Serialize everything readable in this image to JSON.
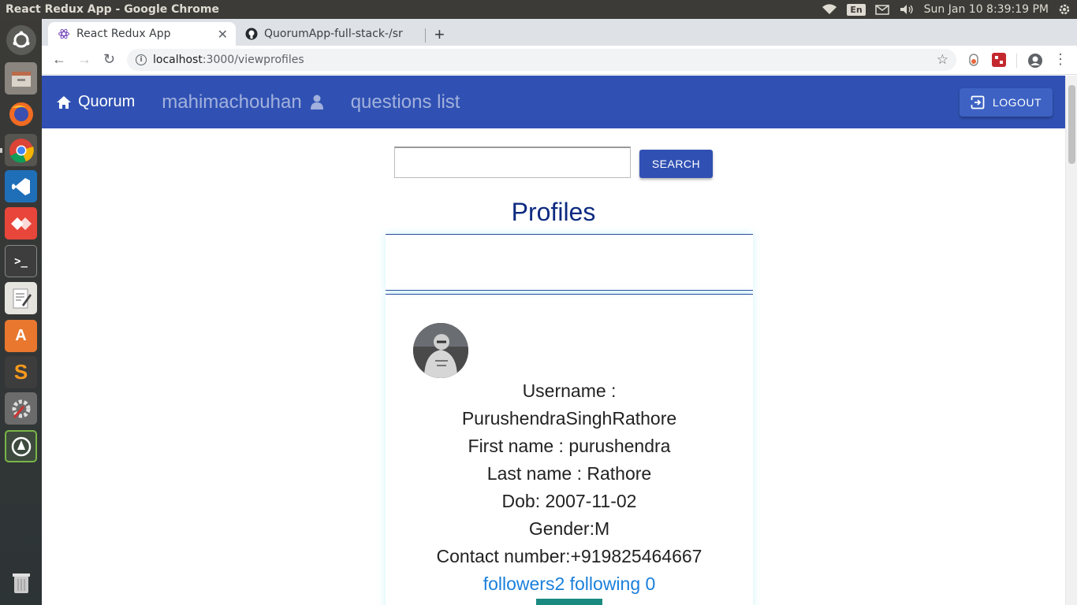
{
  "os": {
    "window_title": "React Redux App - Google Chrome",
    "keyboard_layout": "En",
    "clock": "Sun Jan 10  8:39:19 PM"
  },
  "browser": {
    "tabs": [
      {
        "title": "React Redux App",
        "active": true
      },
      {
        "title": "QuorumApp-full-stack-/sr",
        "active": false
      }
    ],
    "url_host": "localhost",
    "url_rest": ":3000/viewprofiles"
  },
  "navbar": {
    "brand": "Quorum",
    "user_link": "mahimachouhan",
    "questions_link": "questions list",
    "logout_label": "LOGOUT"
  },
  "search": {
    "value": "",
    "button_label": "SEARCH"
  },
  "profiles": {
    "title": "Profiles",
    "card": {
      "username_line1": "Username :",
      "username_line2": "PurushendraSinghRathore",
      "first_name": "First name : purushendra",
      "last_name": "Last name : Rathore",
      "dob": "Dob: 2007-11-02",
      "gender": "Gender:M",
      "contact": "Contact number:+919825464667",
      "follow_stats": "followers2 following 0"
    }
  },
  "colors": {
    "navbar": "#3051b3",
    "title": "#0d2a80",
    "link": "#1a7fdb"
  }
}
